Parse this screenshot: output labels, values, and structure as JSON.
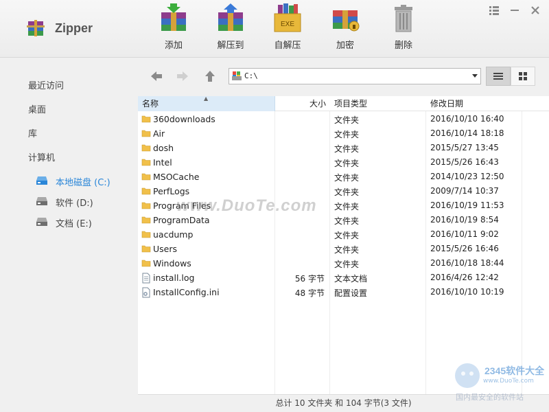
{
  "app": {
    "title": "Zipper"
  },
  "toolbar": {
    "add_label": "添加",
    "extract_label": "解压到",
    "sfx_label": "自解压",
    "sfx_badge": "EXE",
    "encrypt_label": "加密",
    "delete_label": "删除"
  },
  "sidebar": {
    "recent": "最近访问",
    "desktop": "桌面",
    "library": "库",
    "computer": "计算机",
    "drives": [
      {
        "label": "本地磁盘 (C:)",
        "active": true
      },
      {
        "label": "软件 (D:)",
        "active": false
      },
      {
        "label": "文档 (E:)",
        "active": false
      }
    ]
  },
  "address": {
    "path": "C:\\"
  },
  "columns": {
    "name": "名称",
    "size": "大小",
    "type": "项目类型",
    "date": "修改日期"
  },
  "files": [
    {
      "name": "360downloads",
      "size": "",
      "type": "文件夹",
      "date": "2016/10/10 16:40",
      "icon": "folder-icon"
    },
    {
      "name": "Air",
      "size": "",
      "type": "文件夹",
      "date": "2016/10/14 18:18",
      "icon": "folder-icon"
    },
    {
      "name": "dosh",
      "size": "",
      "type": "文件夹",
      "date": "2015/5/27 13:45",
      "icon": "folder-icon"
    },
    {
      "name": "Intel",
      "size": "",
      "type": "文件夹",
      "date": "2015/5/26 16:43",
      "icon": "folder-icon"
    },
    {
      "name": "MSOCache",
      "size": "",
      "type": "文件夹",
      "date": "2014/10/23 12:50",
      "icon": "folder-icon"
    },
    {
      "name": "PerfLogs",
      "size": "",
      "type": "文件夹",
      "date": "2009/7/14 10:37",
      "icon": "folder-icon"
    },
    {
      "name": "Program Files",
      "size": "",
      "type": "文件夹",
      "date": "2016/10/19 11:53",
      "icon": "folder-icon"
    },
    {
      "name": "ProgramData",
      "size": "",
      "type": "文件夹",
      "date": "2016/10/19 8:54",
      "icon": "folder-icon"
    },
    {
      "name": "uacdump",
      "size": "",
      "type": "文件夹",
      "date": "2016/10/11 9:02",
      "icon": "folder-icon"
    },
    {
      "name": "Users",
      "size": "",
      "type": "文件夹",
      "date": "2015/5/26 16:46",
      "icon": "folder-icon"
    },
    {
      "name": "Windows",
      "size": "",
      "type": "文件夹",
      "date": "2016/10/18 18:44",
      "icon": "folder-icon"
    },
    {
      "name": "install.log",
      "size": "56 字节",
      "type": "文本文档",
      "date": "2016/4/26 12:42",
      "icon": "text-file-icon"
    },
    {
      "name": "InstallConfig.ini",
      "size": "48 字节",
      "type": "配置设置",
      "date": "2016/10/10 10:19",
      "icon": "settings-file-icon"
    }
  ],
  "status": {
    "summary": "总计 10 文件夹 和 104 字节(3 文件)"
  },
  "watermark": {
    "site": "www.DuoTe.com",
    "brand": "2345软件大全",
    "brand_url": "www.DuoTe.com",
    "brand_tagline": "国内最安全的软件站"
  },
  "colors": {
    "accent": "#2a86d8",
    "folder": "#f1c04a",
    "selected_header": "#dcebf8"
  }
}
